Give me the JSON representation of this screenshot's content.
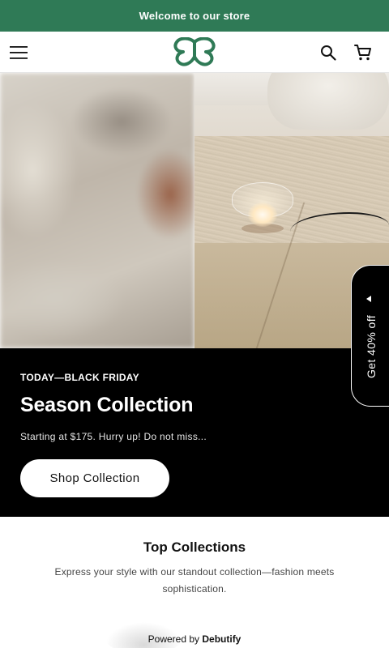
{
  "announcement": {
    "text": "Welcome to our store"
  },
  "header": {
    "menu_icon": "hamburger-menu-icon",
    "logo_icon": "butterfly-logo",
    "search_icon": "search-icon",
    "cart_icon": "cart-icon"
  },
  "hero": {
    "eyebrow": "TODAY—BLACK FRIDAY",
    "title": "Season Collection",
    "subtitle": "Starting at $175. Hurry up! Do not miss...",
    "cta_label": "Shop Collection"
  },
  "discount_tab": {
    "label": "Get 40% off"
  },
  "collections": {
    "title": "Top Collections",
    "description": "Express your style with our standout collection—fashion meets sophistication."
  },
  "footer": {
    "powered_prefix": "Powered by",
    "powered_brand": "Debutify"
  },
  "colors": {
    "announcement_bg": "#2f7a56",
    "brand_green": "#2f7a56",
    "promo_bg": "#000000",
    "button_bg": "#ffffff"
  }
}
